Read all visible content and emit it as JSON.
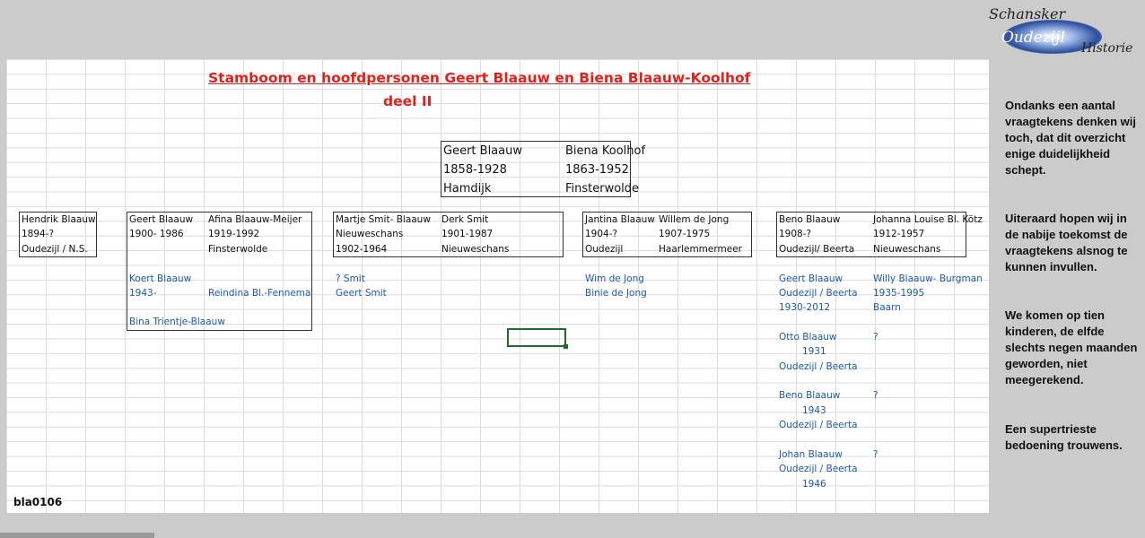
{
  "logo": {
    "line1": "Schansker",
    "line2": "Oudezijl",
    "line3": "Historie"
  },
  "header": {
    "title": "Stamboom en hoofdpersonen Geert Blaauw en Biena Blaauw-Koolhof",
    "subtitle": "deel II"
  },
  "root": {
    "father": {
      "name": "Geert Blaauw",
      "years": "1858-1928",
      "place": "Hamdijk"
    },
    "mother": {
      "name": "Biena Koolhof",
      "years": "1863-1952",
      "place": "Finsterwolde"
    }
  },
  "families": {
    "hendrik": {
      "name": "Hendrik Blaauw",
      "years": "1894-?",
      "place": "Oudezijl / N.S."
    },
    "geert": {
      "p1": {
        "name": "Geert Blaauw",
        "years": "1900- 1986"
      },
      "p2": {
        "name": "Afina Blaauw-Meijer",
        "years": "1919-1992",
        "place": "Finsterwolde"
      },
      "children": [
        "Koert Blaauw",
        "1943-",
        "Reindina Bl.-Fennema",
        "Bina Trientje-Blaauw"
      ]
    },
    "martje": {
      "p1": {
        "name": "Martje Smit- Blaauw",
        "place": "Nieuweschans",
        "years": "1902-1964"
      },
      "p2": {
        "name": "Derk Smit",
        "years": "1901-1987",
        "place": "Nieuweschans"
      },
      "children": [
        "? Smit",
        "Geert Smit"
      ]
    },
    "jantina": {
      "p1": {
        "name": "Jantina Blaauw",
        "years": "1904-?",
        "place": "Oudezijl"
      },
      "p2": {
        "name": "Willem de Jong",
        "years": "1907-1975",
        "place": "Haarlemmermeer"
      },
      "children": [
        "Wim de Jong",
        "Binie de Jong"
      ]
    },
    "beno": {
      "p1": {
        "name": "Beno Blaauw",
        "years": "1908-?",
        "place": "Oudezijl/ Beerta"
      },
      "p2": {
        "name": "Johanna Louise Bl. Kötz",
        "years": "1912-1957",
        "place": "Nieuweschans"
      },
      "children": [
        {
          "name": "Geert Blaauw",
          "place": "Oudezijl / Beerta",
          "years": "1930-2012",
          "spouse": "Willy Blaauw- Burgman",
          "spouse_years": "1935-1995",
          "spouse_place": "Baarn"
        },
        {
          "name": "Otto Blaauw",
          "years": "1931",
          "place": "Oudezijl / Beerta",
          "spouse": "?"
        },
        {
          "name": "Beno Blaauw",
          "years": "1943",
          "place": "Oudezijl / Beerta",
          "spouse": "?"
        },
        {
          "name": "Johan Blaauw",
          "place": "Oudezijl / Beerta",
          "years": "1946",
          "spouse": "?"
        }
      ]
    }
  },
  "code": "bla0106",
  "sidebar": {
    "p1": "Ondanks een aantal vraagtekens denken wij toch, dat dit overzicht enige duidelijkheid schept.",
    "p2": "Uiteraard hopen wij in de nabije toekomst de vraagtekens alsnog te kunnen invullen.",
    "p3": "We komen op tien kinderen, de elfde slechts negen maanden geworden, niet meegerekend.",
    "p4": "Een supertrieste bedoening trouwens."
  }
}
